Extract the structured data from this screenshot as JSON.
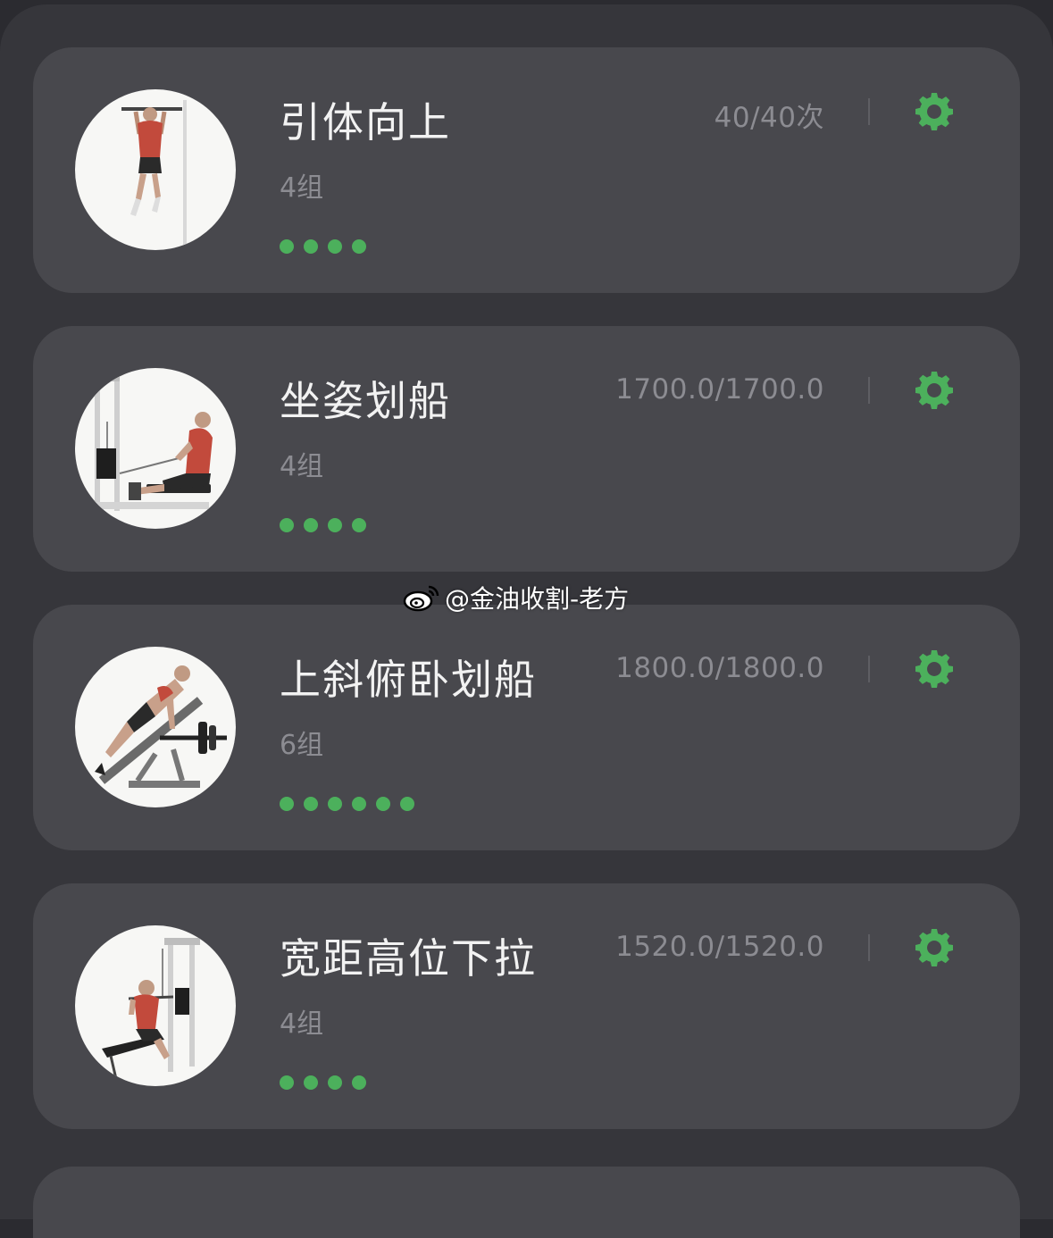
{
  "exercises": [
    {
      "name": "引体向上",
      "sets": "4组",
      "amount": "40/40次",
      "dot_count": 4,
      "image": "pull-up-illustration"
    },
    {
      "name": "坐姿划船",
      "sets": "4组",
      "amount": "1700.0/1700.0",
      "dot_count": 4,
      "image": "seated-cable-row-illustration"
    },
    {
      "name": "上斜俯卧划船",
      "sets": "6组",
      "amount": "1800.0/1800.0",
      "dot_count": 6,
      "image": "incline-chest-supported-row-illustration"
    },
    {
      "name": "宽距高位下拉",
      "sets": "4组",
      "amount": "1520.0/1520.0",
      "dot_count": 4,
      "image": "wide-grip-lat-pulldown-illustration"
    }
  ],
  "watermark": {
    "text": "@金油收割-老方",
    "icon": "weibo-icon"
  },
  "colors": {
    "accent": "#4cb05c",
    "card": "#48484d",
    "background": "#36363b"
  }
}
